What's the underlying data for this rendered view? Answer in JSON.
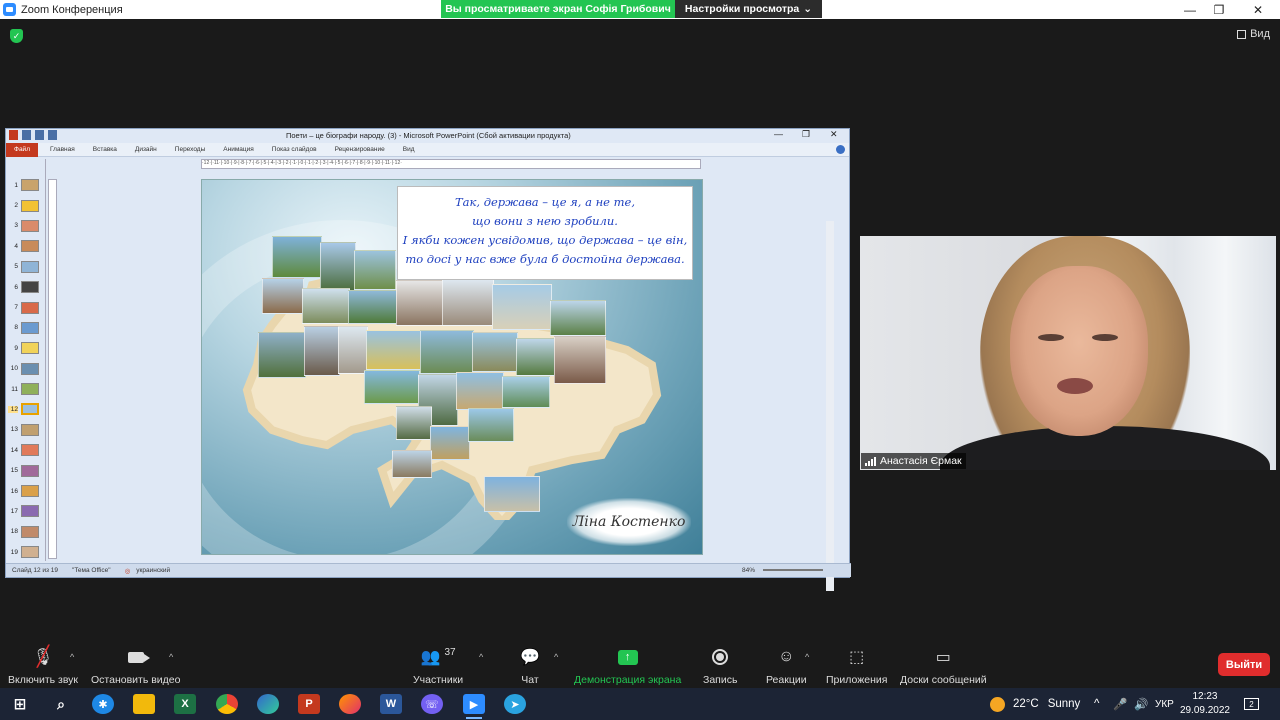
{
  "window": {
    "title": "Zoom Конференция",
    "minimize": "—",
    "maximize": "❐",
    "close": "✕"
  },
  "share_banner": {
    "viewing_text": "Вы просматриваете экран Софія Грибович",
    "view_settings": "Настройки просмотра"
  },
  "view_button": {
    "label": "Вид"
  },
  "ppt": {
    "title": "Поети – це біографи народу. (3) - Microsoft PowerPoint (Сбой активации продукта)",
    "tabs": [
      "Файл",
      "Главная",
      "Вставка",
      "Дизайн",
      "Переходы",
      "Анимация",
      "Показ слайдов",
      "Рецензирование",
      "Вид"
    ],
    "ruler_text": "·12·|·11·|·10·|·9·|·8·|·7·|·6·|·5·|·4·|·3·|·2·|·1·|·0·|·1·|·2·|·3·|·4·|·5·|·6·|·7·|·8·|·9·|·10·|·11·|·12·",
    "thumbs": [
      "1",
      "2",
      "3",
      "4",
      "5",
      "6",
      "7",
      "8",
      "9",
      "10",
      "11",
      "12",
      "13",
      "14",
      "15",
      "16",
      "17",
      "18",
      "19"
    ],
    "selected_slide": "12",
    "quote": [
      "Так, держава – це я, а не те,",
      "що вони з нею зробили.",
      "І якби кожен усвідомив, що держава – це він,",
      "то досі у нас вже була б достойна держава."
    ],
    "signature": "Ліна Костенко",
    "status": {
      "slide": "Слайд 12 из 19",
      "theme": "\"Тема Office\"",
      "language": "украинский",
      "zoom": "84%"
    }
  },
  "video": {
    "participant": "Анастасія Єрмак"
  },
  "toolbar": {
    "mute": "Включить звук",
    "video": "Остановить видео",
    "participants": "Участники",
    "participants_count": "37",
    "chat": "Чат",
    "share": "Демонстрация экрана",
    "record": "Запись",
    "reactions": "Реакции",
    "apps": "Приложения",
    "whiteboard": "Доски сообщений",
    "leave": "Выйти"
  },
  "taskbar": {
    "weather_temp": "22°C",
    "weather_text": "Sunny",
    "lang": "УКР",
    "time": "12:23",
    "date": "29.09.2022",
    "notifications": "2",
    "apps": [
      "windows-icon",
      "search-icon",
      "app-icon",
      "explorer-icon",
      "excel-icon",
      "chrome-icon",
      "edge-icon",
      "powerpoint-icon",
      "firefox-icon",
      "word-icon",
      "viber-icon",
      "zoom-icon",
      "telegram-icon"
    ]
  },
  "colors": {
    "zoom_green": "#23c552",
    "leave_red": "#e02d2d",
    "zoom_blue": "#2d8cff",
    "quote_blue": "#1d3fbf"
  }
}
